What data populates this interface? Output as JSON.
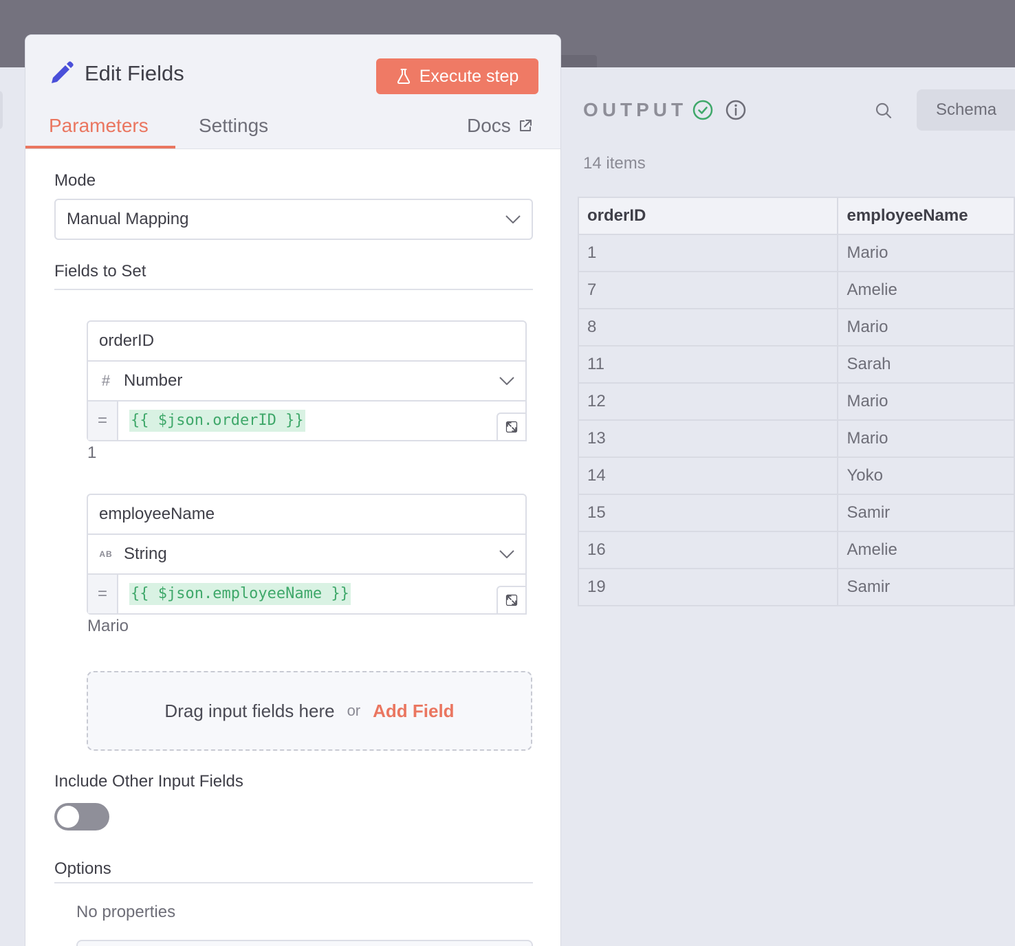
{
  "panel": {
    "title": "Edit Fields",
    "execute_label": "Execute step",
    "tabs": [
      "Parameters",
      "Settings"
    ],
    "docs_label": "Docs",
    "mode": {
      "label": "Mode",
      "value": "Manual Mapping"
    },
    "fields_to_set_label": "Fields to Set",
    "fields": [
      {
        "name": "orderID",
        "type": "Number",
        "type_icon": "hash-icon",
        "expression": "{{ $json.orderID }}",
        "result": "1"
      },
      {
        "name": "employeeName",
        "type": "String",
        "type_icon": "ab-string-icon",
        "type_icon_text": "AB",
        "expression": "{{ $json.employeeName }}",
        "result": "Mario"
      }
    ],
    "dropzone": {
      "text": "Drag input fields here",
      "or": "or",
      "add_label": "Add Field"
    },
    "include_other": {
      "label": "Include Other Input Fields",
      "enabled": false
    },
    "options": {
      "label": "Options",
      "empty_text": "No properties"
    }
  },
  "output": {
    "title": "OUTPUT",
    "schema_label": "Schema",
    "items_count": "14 items",
    "columns": [
      "orderID",
      "employeeName"
    ],
    "rows": [
      [
        "1",
        "Mario"
      ],
      [
        "7",
        "Amelie"
      ],
      [
        "8",
        "Mario"
      ],
      [
        "11",
        "Sarah"
      ],
      [
        "12",
        "Mario"
      ],
      [
        "13",
        "Mario"
      ],
      [
        "14",
        "Yoko"
      ],
      [
        "15",
        "Samir"
      ],
      [
        "16",
        "Amelie"
      ],
      [
        "19",
        "Samir"
      ]
    ]
  },
  "colors": {
    "accent": "#ea7660",
    "execute_bg": "#ef7a65",
    "pencil": "#4a4fd9",
    "expression_bg": "#d9f2e3",
    "expression_text": "#3fa86a",
    "success": "#3fa86a"
  }
}
